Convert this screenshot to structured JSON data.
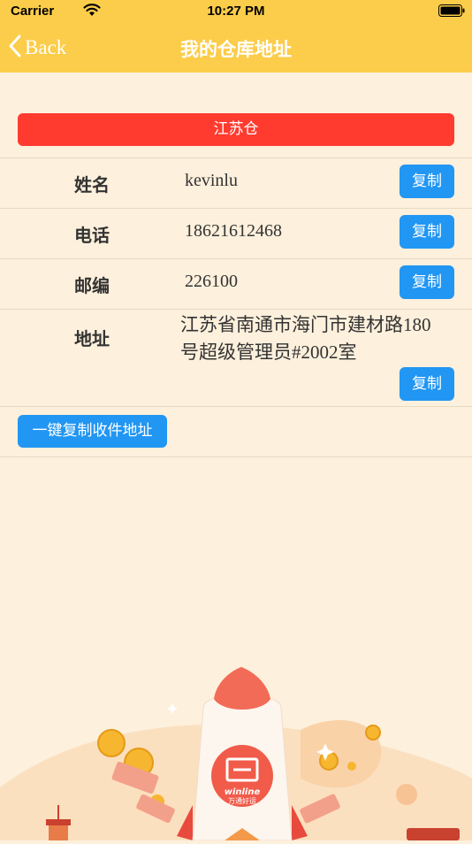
{
  "status_bar": {
    "carrier": "Carrier",
    "time": "10:27 PM"
  },
  "nav": {
    "back_label": "Back",
    "title": "我的仓库地址"
  },
  "warehouse": {
    "name": "江苏仓"
  },
  "rows": [
    {
      "label": "姓名",
      "value": "kevinlu",
      "button": "复制"
    },
    {
      "label": "电话",
      "value": "18621612468",
      "button": "复制"
    },
    {
      "label": "邮编",
      "value": "226100",
      "button": "复制"
    },
    {
      "label": "地址",
      "value": "江苏省南通市海门市建材路180号超级管理员#2002室",
      "button": "复制"
    }
  ],
  "one_key_copy": "一键复制收件地址",
  "logo": {
    "text": "winline",
    "subtext": "万通好运"
  },
  "colors": {
    "header": "#fccd4a",
    "background": "#fdf0dc",
    "warehouse_bar": "#ff3b30",
    "button": "#2196f3"
  }
}
